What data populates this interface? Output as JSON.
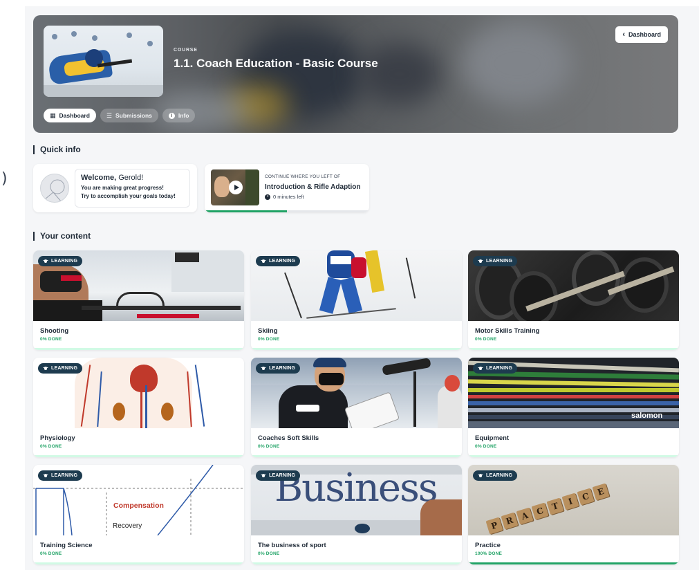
{
  "stray_char": ")",
  "hero": {
    "label": "COURSE",
    "title": "1.1. Coach Education - Basic Course",
    "back_label": "Dashboard",
    "tabs": [
      {
        "label": "Dashboard",
        "icon": "dashboard-icon",
        "active": true
      },
      {
        "label": "Submissions",
        "icon": "list-icon",
        "active": false
      },
      {
        "label": "Info",
        "icon": "info-icon",
        "active": false
      }
    ]
  },
  "quick_info": {
    "heading": "Quick info",
    "welcome": {
      "greeting_prefix": "Welcome,",
      "name": "Gerold!",
      "line1": "You are making great progress!",
      "line2": "Try to accomplish your goals today!"
    },
    "continue": {
      "label": "CONTINUE WHERE YOU LEFT OF",
      "title": "Introduction & Rifle Adaption",
      "time": "0 minutes left",
      "progress": 0.5
    }
  },
  "content": {
    "heading": "Your content",
    "badge_label": "LEARNING",
    "cards": [
      {
        "title": "Shooting",
        "status": "0% DONE",
        "progress": 0
      },
      {
        "title": "Skiing",
        "status": "0% DONE",
        "progress": 0
      },
      {
        "title": "Motor Skills Training",
        "status": "0% DONE",
        "progress": 0
      },
      {
        "title": "Physiology",
        "status": "0% DONE",
        "progress": 0
      },
      {
        "title": "Coaches Soft Skills",
        "status": "0% DONE",
        "progress": 0
      },
      {
        "title": "Equipment",
        "status": "0% DONE",
        "progress": 0
      },
      {
        "title": "Training Science",
        "status": "0% DONE",
        "progress": 0
      },
      {
        "title": "The business of sport",
        "status": "0% DONE",
        "progress": 0
      },
      {
        "title": "Practice",
        "status": "100% DONE",
        "progress": 1
      }
    ],
    "image_text": {
      "training_science_1": "Compensation",
      "training_science_2": "Recovery",
      "business_word": "Business",
      "equipment_brand": "salomon",
      "practice_word": "PRACTICE"
    }
  },
  "colors": {
    "accent_green": "#21a366",
    "badge_bg": "#1d3b4f",
    "text_dark": "#1f2a37"
  }
}
